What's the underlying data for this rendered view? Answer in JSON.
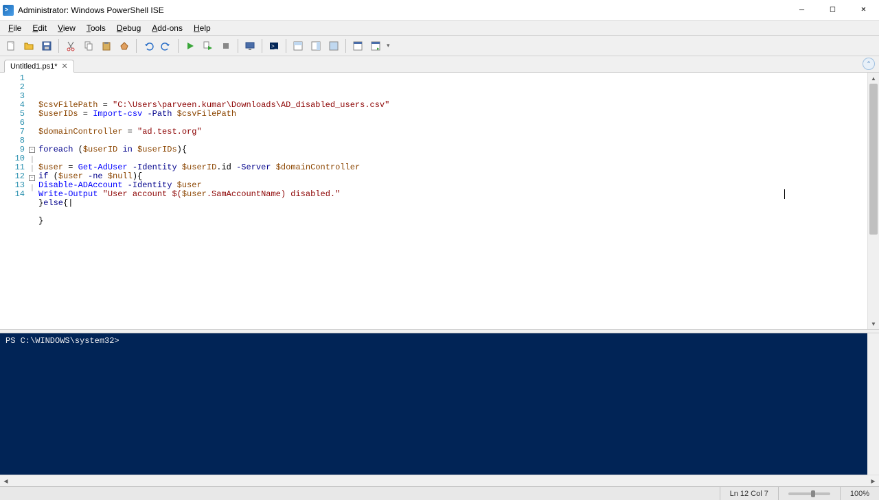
{
  "window": {
    "title": "Administrator: Windows PowerShell ISE"
  },
  "menu": {
    "file": "File",
    "edit": "Edit",
    "view": "View",
    "tools": "Tools",
    "debug": "Debug",
    "addons": "Add-ons",
    "help": "Help"
  },
  "tab": {
    "name": "Untitled1.ps1*"
  },
  "code_lines": [
    {
      "n": 1,
      "fold": "",
      "segs": [
        {
          "c": "v",
          "t": "$csvFilePath"
        },
        {
          "c": "t",
          "t": " = "
        },
        {
          "c": "s",
          "t": "\"C:\\Users\\parveen.kumar\\Downloads\\AD_disabled_users.csv\""
        }
      ]
    },
    {
      "n": 2,
      "fold": "",
      "segs": [
        {
          "c": "v",
          "t": "$userIDs"
        },
        {
          "c": "t",
          "t": " = "
        },
        {
          "c": "c",
          "t": "Import-csv"
        },
        {
          "c": "t",
          "t": " "
        },
        {
          "c": "p",
          "t": "-Path"
        },
        {
          "c": "t",
          "t": " "
        },
        {
          "c": "v",
          "t": "$csvFilePath"
        }
      ]
    },
    {
      "n": 3,
      "fold": "",
      "segs": []
    },
    {
      "n": 4,
      "fold": "",
      "segs": [
        {
          "c": "v",
          "t": "$domainController"
        },
        {
          "c": "t",
          "t": " = "
        },
        {
          "c": "s",
          "t": "\"ad.test.org\""
        }
      ]
    },
    {
      "n": 5,
      "fold": "",
      "segs": []
    },
    {
      "n": 6,
      "fold": "",
      "segs": [
        {
          "c": "k",
          "t": "foreach"
        },
        {
          "c": "t",
          "t": " ("
        },
        {
          "c": "v",
          "t": "$userID"
        },
        {
          "c": "t",
          "t": " "
        },
        {
          "c": "k",
          "t": "in"
        },
        {
          "c": "t",
          "t": " "
        },
        {
          "c": "v",
          "t": "$userIDs"
        },
        {
          "c": "t",
          "t": "){"
        }
      ]
    },
    {
      "n": 7,
      "fold": "",
      "segs": []
    },
    {
      "n": 8,
      "fold": "",
      "segs": [
        {
          "c": "v",
          "t": "$user"
        },
        {
          "c": "t",
          "t": " = "
        },
        {
          "c": "c",
          "t": "Get-AdUser"
        },
        {
          "c": "t",
          "t": " "
        },
        {
          "c": "p",
          "t": "-Identity"
        },
        {
          "c": "t",
          "t": " "
        },
        {
          "c": "v",
          "t": "$userID"
        },
        {
          "c": "t",
          "t": "."
        },
        {
          "c": "m",
          "t": "id"
        },
        {
          "c": "t",
          "t": " "
        },
        {
          "c": "p",
          "t": "-Server"
        },
        {
          "c": "t",
          "t": " "
        },
        {
          "c": "v",
          "t": "$domainController"
        }
      ]
    },
    {
      "n": 9,
      "fold": "⊟",
      "segs": [
        {
          "c": "k",
          "t": "if"
        },
        {
          "c": "t",
          "t": " ("
        },
        {
          "c": "v",
          "t": "$user"
        },
        {
          "c": "t",
          "t": " "
        },
        {
          "c": "p",
          "t": "-ne"
        },
        {
          "c": "t",
          "t": " "
        },
        {
          "c": "v",
          "t": "$null"
        },
        {
          "c": "t",
          "t": "){"
        }
      ]
    },
    {
      "n": 10,
      "fold": "|",
      "segs": [
        {
          "c": "c",
          "t": "Disable-ADAccount"
        },
        {
          "c": "t",
          "t": " "
        },
        {
          "c": "p",
          "t": "-Identity"
        },
        {
          "c": "t",
          "t": " "
        },
        {
          "c": "v",
          "t": "$user"
        }
      ]
    },
    {
      "n": 11,
      "fold": "|",
      "segs": [
        {
          "c": "c",
          "t": "Write-Output"
        },
        {
          "c": "t",
          "t": " "
        },
        {
          "c": "s",
          "t": "\"User account $("
        },
        {
          "c": "v",
          "t": "$user"
        },
        {
          "c": "s",
          "t": ".SamAccountName) disabled.\""
        }
      ]
    },
    {
      "n": 12,
      "fold": "⊟",
      "segs": [
        {
          "c": "t",
          "t": "}"
        },
        {
          "c": "k",
          "t": "else"
        },
        {
          "c": "t",
          "t": "{|"
        }
      ]
    },
    {
      "n": 13,
      "fold": "|",
      "segs": []
    },
    {
      "n": 14,
      "fold": "",
      "segs": [
        {
          "c": "t",
          "t": "}"
        }
      ]
    }
  ],
  "console": {
    "prompt": "PS C:\\WINDOWS\\system32> "
  },
  "status": {
    "position": "Ln 12  Col 7",
    "zoom": "100%"
  },
  "toolbar_icons": [
    "new-icon",
    "open-icon",
    "save-icon",
    "cut-icon",
    "copy-icon",
    "paste-icon",
    "clear-icon",
    "undo-icon",
    "redo-icon",
    "run-script-icon",
    "run-selection-icon",
    "stop-icon",
    "remote-icon",
    "command-addon-icon",
    "show-script-top-icon",
    "show-script-right-icon",
    "show-script-max-icon",
    "show-command-icon",
    "show-command-addon-icon"
  ]
}
